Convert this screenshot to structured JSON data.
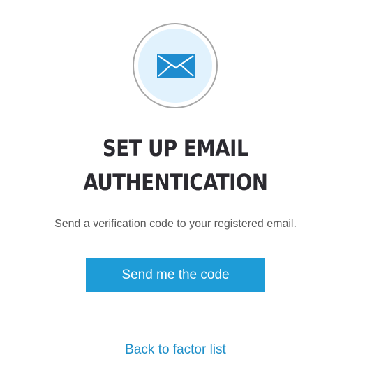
{
  "icon": {
    "name": "email-envelope-icon",
    "color": "#1e8ccf",
    "disc_color": "#e1f2fd"
  },
  "title": {
    "line1": "SET UP EMAIL",
    "line2": "AUTHENTICATION"
  },
  "subtitle": "Send a verification code to your registered email.",
  "send_button": {
    "label": "Send me the code",
    "color": "#1e9cd7"
  },
  "back_link": {
    "label": "Back to factor list",
    "color": "#1e8fc9"
  }
}
